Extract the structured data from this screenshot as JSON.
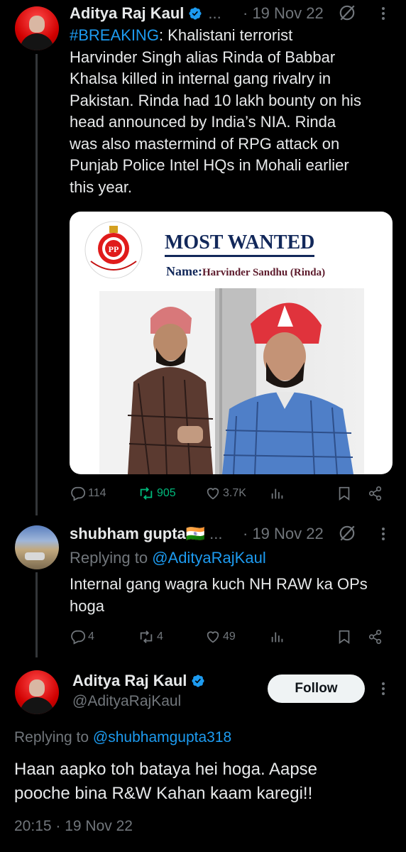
{
  "tweet1": {
    "author_name": "Aditya Raj Kaul",
    "ellipsis": "...",
    "date": "· 19 Nov 22",
    "hashtag": "#BREAKING",
    "text_after_hashtag": ": Khalistani terrorist",
    "lines": [
      "Harvinder Singh alias Rinda of Babbar",
      "Khalsa killed in internal gang rivalry in",
      "Pakistan. Rinda had 10 lakh bounty on his",
      "head announced by India’s NIA. Rinda",
      "was also mastermind of RPG attack on",
      "Punjab Police Intel HQs in Mohali earlier",
      "this year."
    ],
    "media": {
      "title": "MOST WANTED",
      "name_label": "Name:",
      "name_value": "Harvinder Sandhu (Rinda)"
    },
    "actions": {
      "replies": "114",
      "retweets": "905",
      "likes": "3.7K"
    }
  },
  "tweet2": {
    "author_name": "shubham gupta🇮🇳",
    "ellipsis": "...",
    "date": "· 19 Nov 22",
    "replying_prefix": "Replying to ",
    "replying_to": "@AdityaRajKaul",
    "lines": [
      "Internal gang wagra kuch NH RAW ka OPs",
      "hoga"
    ],
    "actions": {
      "replies": "4",
      "retweets": "4",
      "likes": "49"
    }
  },
  "tweet3": {
    "author_name": "Aditya Raj Kaul",
    "handle": "@AdityaRajKaul",
    "follow_label": "Follow",
    "replying_prefix": "Replying to ",
    "replying_to": "@shubhamgupta318",
    "lines": [
      "Haan aapko toh bataya hei hoga. Aapse",
      "pooche bina R&W Kahan kaam karegi!!"
    ],
    "timestamp": "20:15 · 19 Nov 22"
  },
  "colors": {
    "background": "#000000",
    "text": "#e7e9ea",
    "muted": "#71767b",
    "accent": "#1d9bf0",
    "retweet_active": "#00ba7c"
  },
  "icons": [
    "verified-badge-icon",
    "grok-icon",
    "more-icon",
    "reply-icon",
    "retweet-icon",
    "like-icon",
    "views-icon",
    "bookmark-icon",
    "share-icon"
  ]
}
